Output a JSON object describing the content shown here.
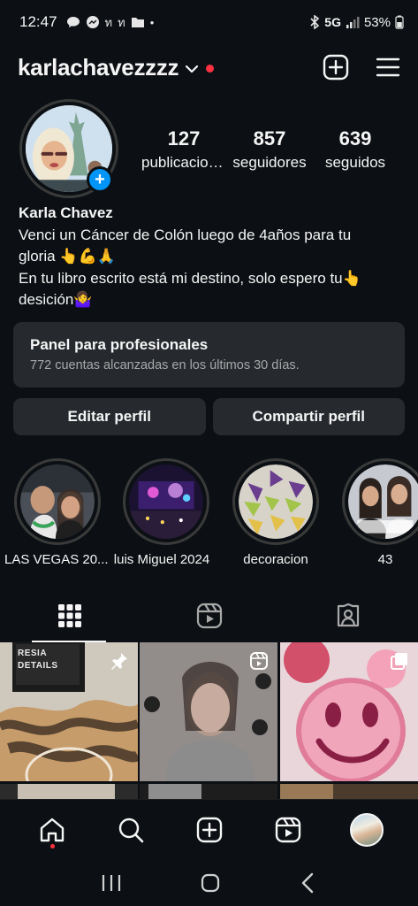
{
  "status_bar": {
    "time": "12:47",
    "notif_icons": [
      "chat-bubble-icon",
      "messenger-icon",
      "app-icon",
      "app-icon",
      "folder-icon",
      "dot-icon"
    ],
    "network": "5G",
    "battery": "53%"
  },
  "header": {
    "username": "karlachavezzzz"
  },
  "profile": {
    "stats": [
      {
        "number": "127",
        "label": "publicaciones"
      },
      {
        "number": "857",
        "label": "seguidores"
      },
      {
        "number": "639",
        "label": "seguidos"
      }
    ],
    "name": "Karla Chavez",
    "bio_lines": [
      "Venci un Cáncer de Colón luego de 4años para tu",
      "gloria 👆💪🙏",
      "En tu libro escrito está mi destino, solo espero tu👆",
      "desición🤷‍♀️"
    ]
  },
  "pro_panel": {
    "title": "Panel para profesionales",
    "subtitle": "772 cuentas alcanzadas en los últimos 30 días."
  },
  "buttons": {
    "edit": "Editar perfil",
    "share": "Compartir perfil"
  },
  "highlights": [
    {
      "label": "LAS VEGAS 20..."
    },
    {
      "label": "luis Miguel 2024"
    },
    {
      "label": "decoracion"
    },
    {
      "label": "43"
    }
  ],
  "grid_text": {
    "post1_sign": "RESIA DETAILS"
  },
  "colors": {
    "background": "#0c1014",
    "accent": "#0095f6",
    "notification": "#ff3040",
    "panel": "#262a2f"
  }
}
